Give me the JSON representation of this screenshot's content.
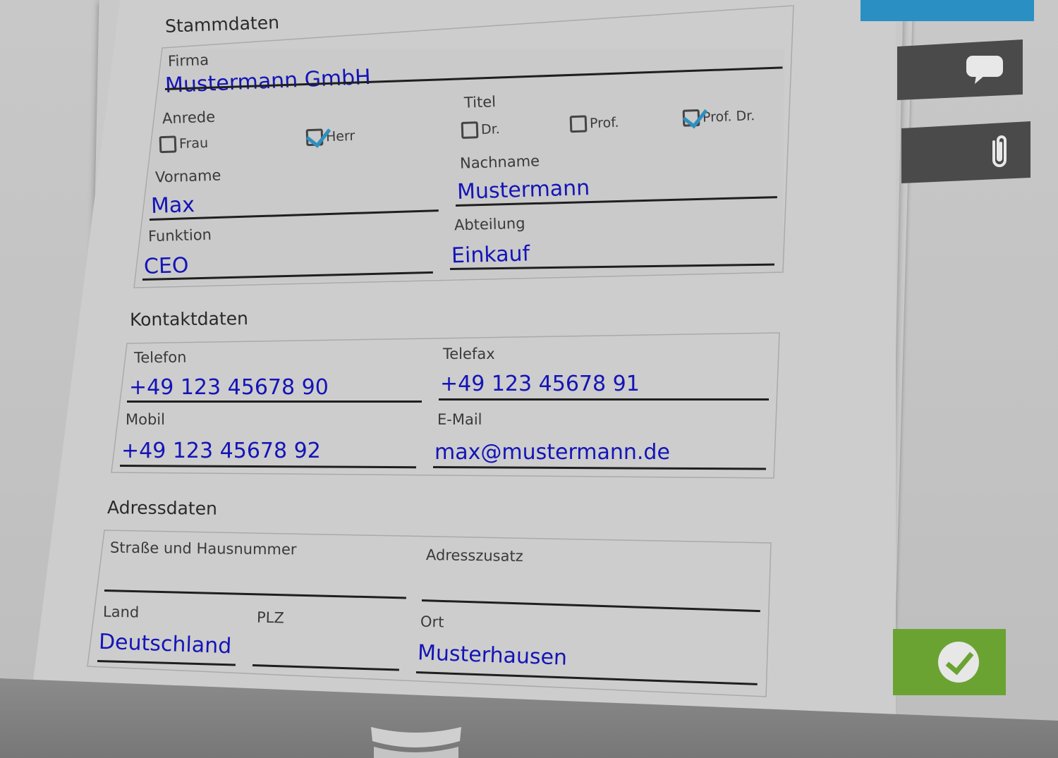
{
  "sections": {
    "stammdaten": {
      "title": "Stammdaten",
      "firma": {
        "label": "Firma",
        "value": "Mustermann GmbH"
      },
      "anrede": {
        "label": "Anrede",
        "options": [
          {
            "label": "Frau",
            "checked": false
          },
          {
            "label": "Herr",
            "checked": true
          }
        ]
      },
      "titel": {
        "label": "Titel",
        "options": [
          {
            "label": "Dr.",
            "checked": false
          },
          {
            "label": "Prof.",
            "checked": false
          },
          {
            "label": "Prof. Dr.",
            "checked": true
          }
        ]
      },
      "vorname": {
        "label": "Vorname",
        "value": "Max"
      },
      "nachname": {
        "label": "Nachname",
        "value": "Mustermann"
      },
      "funktion": {
        "label": "Funktion",
        "value": "CEO"
      },
      "abteilung": {
        "label": "Abteilung",
        "value": "Einkauf"
      }
    },
    "kontaktdaten": {
      "title": "Kontaktdaten",
      "telefon": {
        "label": "Telefon",
        "value": "+49 123 45678 90"
      },
      "telefax": {
        "label": "Telefax",
        "value": "+49 123 45678 91"
      },
      "mobil": {
        "label": "Mobil",
        "value": "+49 123 45678 92"
      },
      "email": {
        "label": "E-Mail",
        "value": "max@mustermann.de"
      }
    },
    "adressdaten": {
      "title": "Adressdaten",
      "strasse": {
        "label": "Straße und Hausnummer",
        "value": ""
      },
      "adresszusatz": {
        "label": "Adresszusatz",
        "value": ""
      },
      "land": {
        "label": "Land",
        "value": "Deutschland"
      },
      "plz": {
        "label": "PLZ",
        "value": ""
      },
      "ort": {
        "label": "Ort",
        "value": "Musterhausen"
      }
    }
  },
  "sidebar": {
    "buttons": [
      {
        "name": "top-blue",
        "icon": "partial-icon",
        "color": "#2a8fc2"
      },
      {
        "name": "comment",
        "icon": "speech-bubble-icon",
        "color": "#4a4a4a"
      },
      {
        "name": "attachment",
        "icon": "paperclip-icon",
        "color": "#4a4a4a"
      },
      {
        "name": "confirm",
        "icon": "checkmark-icon",
        "color": "#6aa332"
      }
    ]
  },
  "colors": {
    "value_text": "#1414b8",
    "check_blue": "#2e8fbf",
    "confirm_green": "#6aa332"
  }
}
